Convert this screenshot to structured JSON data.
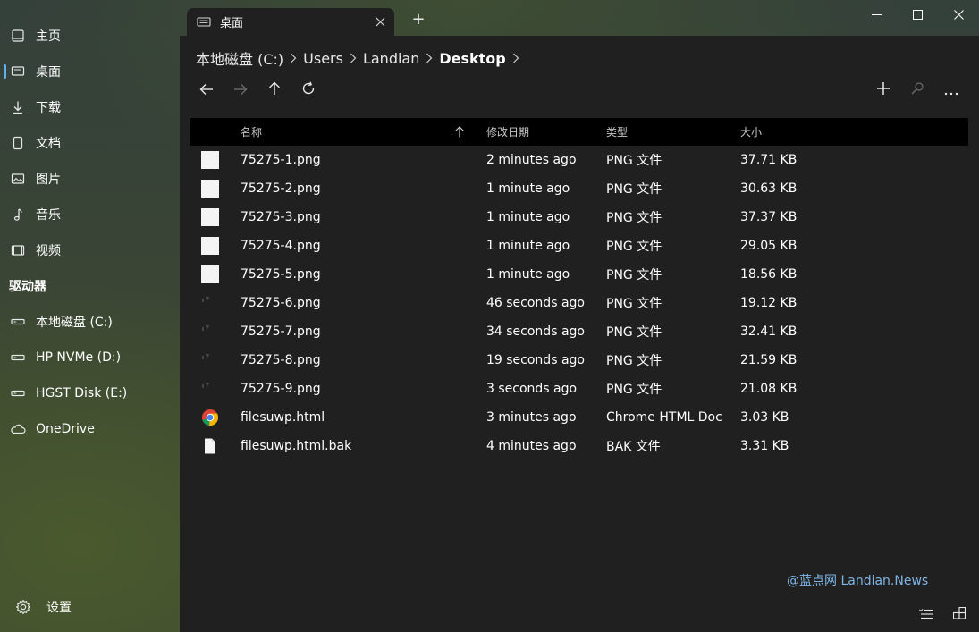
{
  "window": {
    "tab_title": "桌面",
    "new_tab_glyph": "+",
    "controls": [
      "minimize-icon",
      "maximize-icon",
      "close-icon"
    ]
  },
  "sidebar": {
    "items": [
      {
        "label": "主页",
        "icon": "home-icon"
      },
      {
        "label": "桌面",
        "icon": "desktop-icon",
        "selected": true
      },
      {
        "label": "下载",
        "icon": "download-icon"
      },
      {
        "label": "文档",
        "icon": "document-icon"
      },
      {
        "label": "图片",
        "icon": "picture-icon"
      },
      {
        "label": "音乐",
        "icon": "music-icon"
      },
      {
        "label": "视频",
        "icon": "video-icon"
      }
    ],
    "drives_header": "驱动器",
    "drives": [
      {
        "label": "本地磁盘 (C:)",
        "icon": "drive-icon"
      },
      {
        "label": "HP NVMe (D:)",
        "icon": "drive-icon"
      },
      {
        "label": "HGST Disk (E:)",
        "icon": "drive-icon"
      },
      {
        "label": "OneDrive",
        "icon": "cloud-icon"
      }
    ],
    "settings_label": "设置"
  },
  "breadcrumb": [
    "本地磁盘 (C:)",
    "Users",
    "Landian",
    "Desktop"
  ],
  "toolbar": {
    "left": [
      "back-arrow-icon",
      "forward-arrow-icon",
      "up-arrow-icon",
      "refresh-icon"
    ],
    "right": [
      "add-icon",
      "search-icon",
      "more-icon"
    ]
  },
  "table": {
    "headers": {
      "name": "名称",
      "modified": "修改日期",
      "type": "类型",
      "size": "大小"
    },
    "sort_icon": "sort-up-arrow-icon",
    "rows": [
      {
        "name": "75275-1.png",
        "modified": "2 minutes ago",
        "type": "PNG 文件",
        "size": "37.71 KB",
        "thumb": "white"
      },
      {
        "name": "75275-2.png",
        "modified": "1 minute ago",
        "type": "PNG 文件",
        "size": "30.63 KB",
        "thumb": "white"
      },
      {
        "name": "75275-3.png",
        "modified": "1 minute ago",
        "type": "PNG 文件",
        "size": "37.37 KB",
        "thumb": "white"
      },
      {
        "name": "75275-4.png",
        "modified": "1 minute ago",
        "type": "PNG 文件",
        "size": "29.05 KB",
        "thumb": "white"
      },
      {
        "name": "75275-5.png",
        "modified": "1 minute ago",
        "type": "PNG 文件",
        "size": "18.56 KB",
        "thumb": "white"
      },
      {
        "name": "75275-6.png",
        "modified": "46 seconds ago",
        "type": "PNG 文件",
        "size": "19.12 KB",
        "thumb": "faint"
      },
      {
        "name": "75275-7.png",
        "modified": "34 seconds ago",
        "type": "PNG 文件",
        "size": "32.41 KB",
        "thumb": "faint"
      },
      {
        "name": "75275-8.png",
        "modified": "19 seconds ago",
        "type": "PNG 文件",
        "size": "21.59 KB",
        "thumb": "faint"
      },
      {
        "name": "75275-9.png",
        "modified": "3 seconds ago",
        "type": "PNG 文件",
        "size": "21.08 KB",
        "thumb": "faint"
      },
      {
        "name": "filesuwp.html",
        "modified": "3 minutes ago",
        "type": "Chrome HTML Doc",
        "size": "3.03 KB",
        "thumb": "chrome"
      },
      {
        "name": "filesuwp.html.bak",
        "modified": "4 minutes ago",
        "type": "BAK 文件",
        "size": "3.31 KB",
        "thumb": "file"
      }
    ]
  },
  "watermark": "@蓝点网 Landian.News",
  "status_bar": [
    "details-view-icon",
    "tiles-view-icon"
  ],
  "colors": {
    "accent": "#5fb2f2",
    "watermark": "#7fb6e6",
    "panel": "#202020",
    "header": "#000000"
  }
}
